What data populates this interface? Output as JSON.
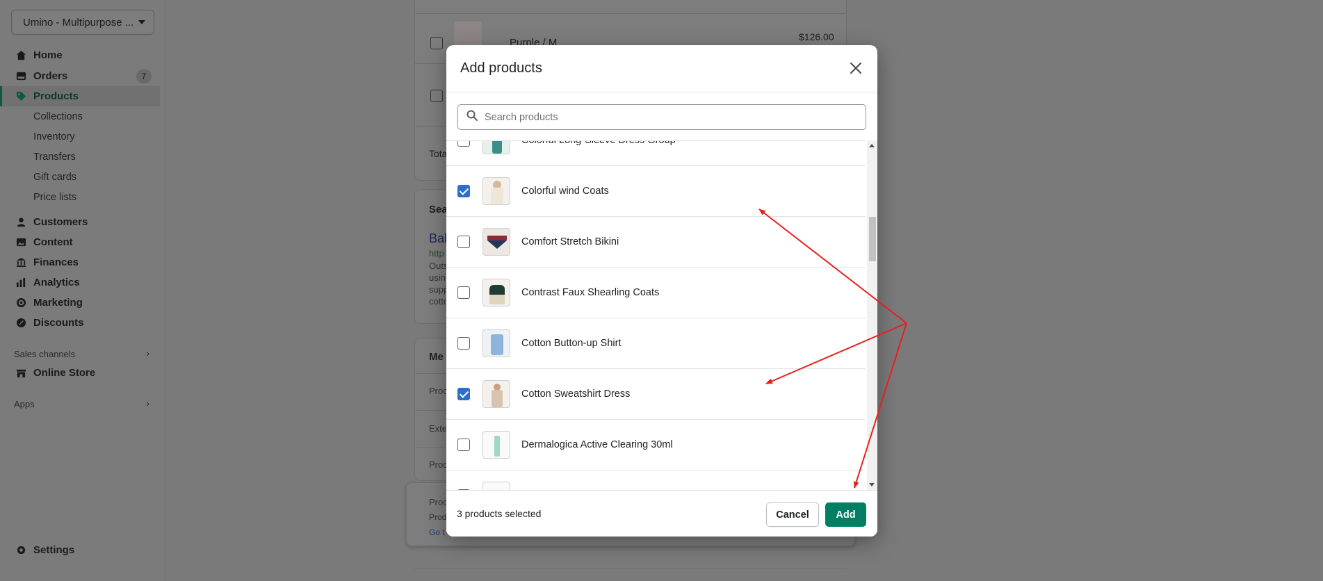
{
  "sidebar": {
    "store_name": "Umino - Multipurpose ...",
    "items": [
      {
        "label": "Home",
        "icon": "home-icon"
      },
      {
        "label": "Orders",
        "icon": "orders-icon",
        "badge": "7"
      },
      {
        "label": "Products",
        "icon": "tag-icon",
        "active": true
      },
      {
        "label": "Collections",
        "sub": true
      },
      {
        "label": "Inventory",
        "sub": true
      },
      {
        "label": "Transfers",
        "sub": true
      },
      {
        "label": "Gift cards",
        "sub": true
      },
      {
        "label": "Price lists",
        "sub": true
      },
      {
        "label": "Customers",
        "icon": "person-icon"
      },
      {
        "label": "Content",
        "icon": "content-icon"
      },
      {
        "label": "Finances",
        "icon": "bank-icon"
      },
      {
        "label": "Analytics",
        "icon": "bar-chart-icon"
      },
      {
        "label": "Marketing",
        "icon": "target-icon"
      },
      {
        "label": "Discounts",
        "icon": "discount-icon"
      },
      {
        "label": "Online Store",
        "icon": "store-icon"
      }
    ],
    "sales_channels_label": "Sales channels",
    "apps_label": "Apps",
    "settings_label": "Settings"
  },
  "background": {
    "variant_label": "Purple / M",
    "variant_price": "$126.00",
    "total_label": "Tota",
    "sea_label": "Sea",
    "bal_label": "Bal",
    "http_label": "http",
    "outs_lines": [
      "Outs",
      "usin",
      "supp",
      "cotto"
    ],
    "me_label": "Me",
    "proc_label_1": "Proc",
    "exte_label": "Exte",
    "proc_label_2": "Proc",
    "proc_label_3": "Proc",
    "prod_label": "Prod",
    "go_label": "Go t"
  },
  "modal": {
    "title": "Add products",
    "search_placeholder": "Search products",
    "products": [
      {
        "name": "Colorful Long-Sleeve Dress Group",
        "checked": false
      },
      {
        "name": "Colorful wind Coats",
        "checked": true
      },
      {
        "name": "Comfort Stretch Bikini",
        "checked": false
      },
      {
        "name": "Contrast Faux Shearling Coats",
        "checked": false
      },
      {
        "name": "Cotton Button-up Shirt",
        "checked": false
      },
      {
        "name": "Cotton Sweatshirt Dress",
        "checked": true
      },
      {
        "name": "Dermalogica Active Clearing 30ml",
        "checked": false
      },
      {
        "name": "",
        "checked": false
      }
    ],
    "selected_text": "3 products selected",
    "cancel_label": "Cancel",
    "add_label": "Add"
  },
  "colors": {
    "primary": "#008060",
    "checkbox": "#2c6ecb",
    "annotation": "#e8201c"
  }
}
